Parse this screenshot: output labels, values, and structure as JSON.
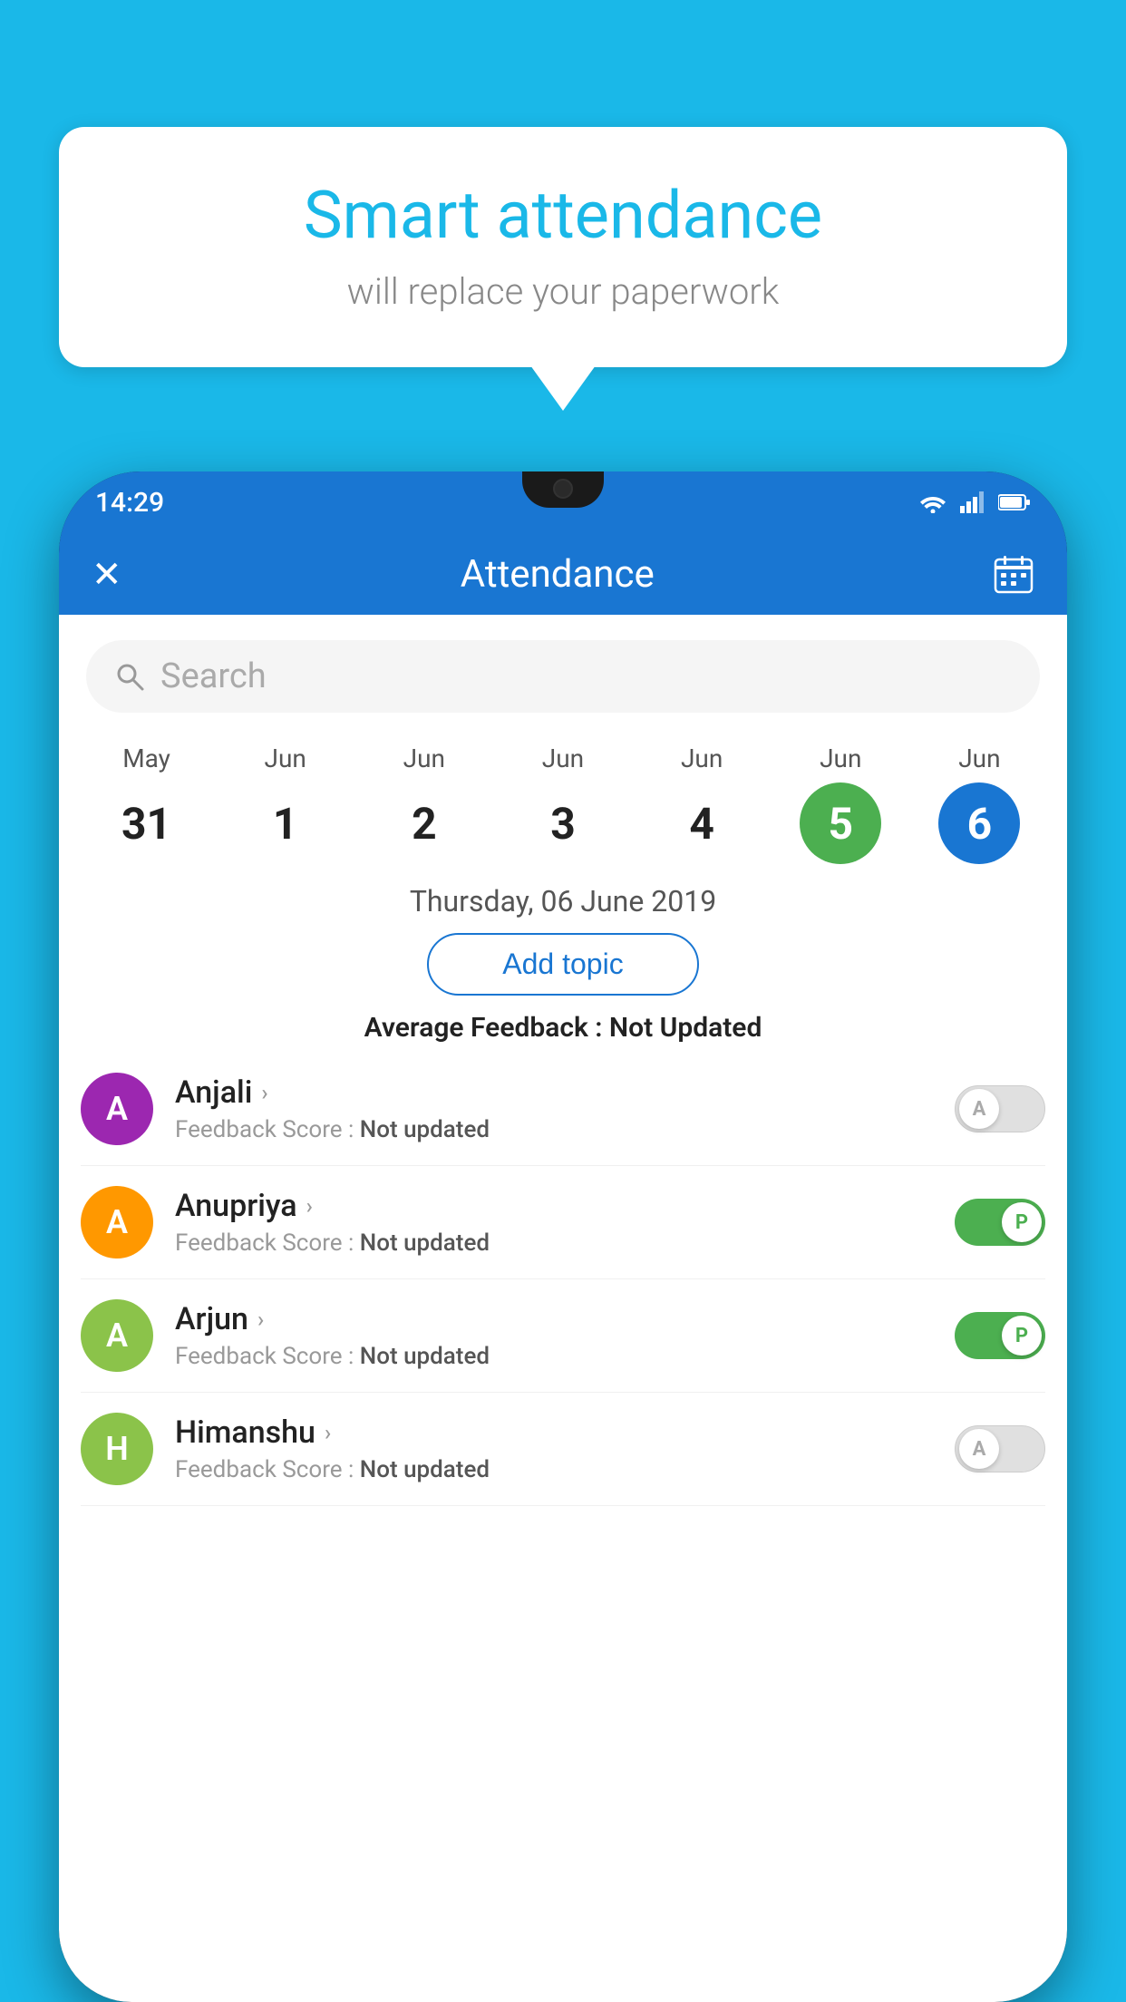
{
  "background_color": "#1ab8e8",
  "speech_bubble": {
    "title": "Smart attendance",
    "subtitle": "will replace your paperwork"
  },
  "status_bar": {
    "time": "14:29"
  },
  "app_header": {
    "title": "Attendance",
    "close_label": "×",
    "calendar_icon": "📅"
  },
  "search": {
    "placeholder": "Search"
  },
  "calendar": {
    "days": [
      {
        "month": "May",
        "date": "31",
        "state": "normal"
      },
      {
        "month": "Jun",
        "date": "1",
        "state": "normal"
      },
      {
        "month": "Jun",
        "date": "2",
        "state": "normal"
      },
      {
        "month": "Jun",
        "date": "3",
        "state": "normal"
      },
      {
        "month": "Jun",
        "date": "4",
        "state": "normal"
      },
      {
        "month": "Jun",
        "date": "5",
        "state": "today"
      },
      {
        "month": "Jun",
        "date": "6",
        "state": "selected"
      }
    ]
  },
  "selected_date": "Thursday, 06 June 2019",
  "add_topic_label": "Add topic",
  "average_feedback_label": "Average Feedback :",
  "average_feedback_value": "Not Updated",
  "students": [
    {
      "name": "Anjali",
      "avatar_letter": "A",
      "avatar_color": "#9c27b0",
      "feedback_label": "Feedback Score :",
      "feedback_value": "Not updated",
      "toggle_state": "off",
      "toggle_letter": "A"
    },
    {
      "name": "Anupriya",
      "avatar_letter": "A",
      "avatar_color": "#ff9800",
      "feedback_label": "Feedback Score :",
      "feedback_value": "Not updated",
      "toggle_state": "on",
      "toggle_letter": "P"
    },
    {
      "name": "Arjun",
      "avatar_letter": "A",
      "avatar_color": "#8bc34a",
      "feedback_label": "Feedback Score :",
      "feedback_value": "Not updated",
      "toggle_state": "on",
      "toggle_letter": "P"
    },
    {
      "name": "Himanshu",
      "avatar_letter": "H",
      "avatar_color": "#8bc34a",
      "feedback_label": "Feedback Score :",
      "feedback_value": "Not updated",
      "toggle_state": "off",
      "toggle_letter": "A"
    }
  ]
}
